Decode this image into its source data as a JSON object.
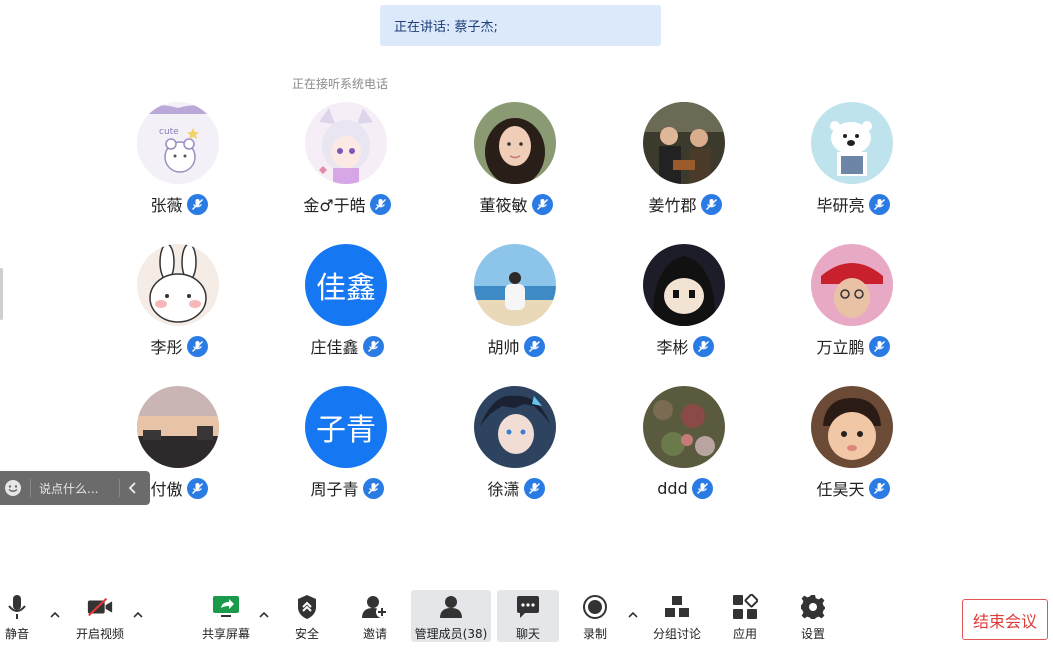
{
  "banner": {
    "speaking": "正在讲话: 蔡子杰;"
  },
  "status": {
    "system_call": "正在接听系统电话"
  },
  "participants": [
    {
      "name": "张薇",
      "avatar": "photo",
      "avatar_desc": "cute-bear"
    },
    {
      "name": "金♂于皓",
      "avatar": "photo",
      "avatar_desc": "anime-cat-girl"
    },
    {
      "name": "董筱敏",
      "avatar": "photo",
      "avatar_desc": "portrait"
    },
    {
      "name": "姜竹郡",
      "avatar": "photo",
      "avatar_desc": "movie-still"
    },
    {
      "name": "毕研亮",
      "avatar": "photo",
      "avatar_desc": "polar-bear"
    },
    {
      "name": "李彤",
      "avatar": "photo",
      "avatar_desc": "bunny-sticker"
    },
    {
      "name": "庄佳鑫",
      "avatar": "initials",
      "initials": "佳鑫"
    },
    {
      "name": "胡帅",
      "avatar": "photo",
      "avatar_desc": "beach"
    },
    {
      "name": "李彬",
      "avatar": "photo",
      "avatar_desc": "anime-boy"
    },
    {
      "name": "万立鹏",
      "avatar": "photo",
      "avatar_desc": "red-hat"
    },
    {
      "name": "付傲",
      "avatar": "photo",
      "avatar_desc": "sunset"
    },
    {
      "name": "周子青",
      "avatar": "initials",
      "initials": "子青"
    },
    {
      "name": "徐潇",
      "avatar": "photo",
      "avatar_desc": "anime-fantasy"
    },
    {
      "name": "ddd",
      "avatar": "photo",
      "avatar_desc": "flowers"
    },
    {
      "name": "任昊天",
      "avatar": "photo",
      "avatar_desc": "baby"
    }
  ],
  "chat_popup": {
    "placeholder": "说点什么..."
  },
  "toolbar": {
    "mute": "静音",
    "video": "开启视频",
    "share": "共享屏幕",
    "security": "安全",
    "invite": "邀请",
    "members": "管理成员(38)",
    "chat": "聊天",
    "record": "录制",
    "breakout": "分组讨论",
    "apps": "应用",
    "settings": "设置",
    "end": "结束会议"
  },
  "colors": {
    "accent": "#2b7be5",
    "initials_bg": "#1677f2",
    "end_red": "#e03b3b",
    "banner_bg": "#dbe9fb"
  }
}
